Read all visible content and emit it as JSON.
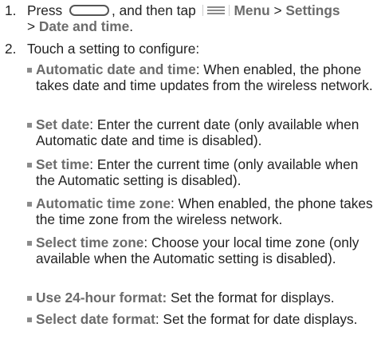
{
  "step1": {
    "number": "1.",
    "press": "Press",
    "then_tap": ", and then tap",
    "menu": "Menu",
    "sep": " > ",
    "settings": "Settings",
    "date_and_time": "Date and time",
    "period": "."
  },
  "step2": {
    "number": "2.",
    "text": "Touch a setting to configure:"
  },
  "bullets": [
    {
      "label": "Automatic date and time",
      "text": ": When enabled, the phone takes date and time updates from the wireless network."
    },
    {
      "label": "Set date",
      "text": ": Enter the current date (only available when Automatic date and time is disabled)."
    },
    {
      "label": "Set time",
      "text": ": Enter the current time (only available when the Automatic setting is disabled)."
    },
    {
      "label": "Automatic time zone",
      "text": ": When enabled, the phone takes the time zone from the wireless network."
    },
    {
      "label": "Select time zone",
      "text": ": Choose your local time zone (only available when the Automatic setting is disabled)."
    },
    {
      "label": "Use 24-hour format:",
      "text": " Set the format for displays."
    },
    {
      "label": "Select date format",
      "text": ": Set the format for date displays."
    }
  ]
}
